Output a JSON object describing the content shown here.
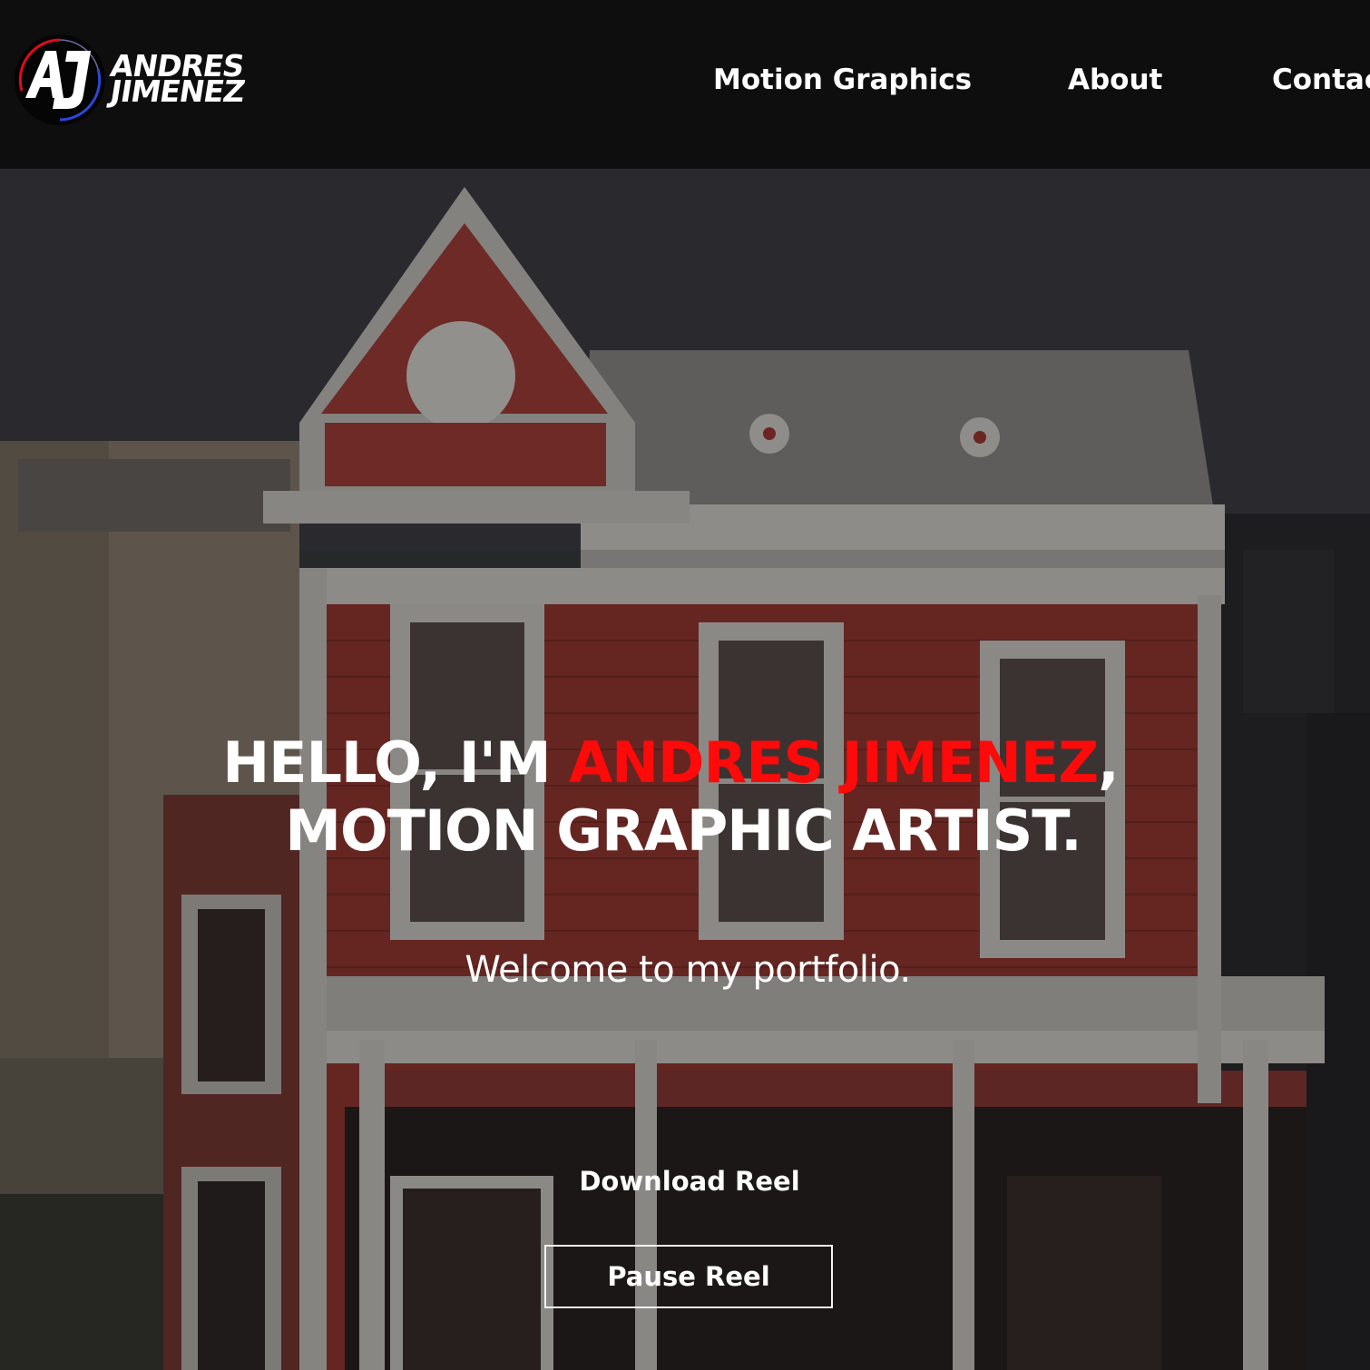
{
  "header": {
    "logo": {
      "monogram": "AJ",
      "first_name": "ANDRES",
      "last_name": "JIMENEZ"
    },
    "nav": [
      {
        "label": "Motion Graphics"
      },
      {
        "label": "About"
      },
      {
        "label": "Contac"
      }
    ]
  },
  "hero": {
    "headline_prefix": "HELLO, I'M ",
    "headline_name": "ANDRES JIMENEZ",
    "headline_suffix": ",",
    "headline_line2": "MOTION GRAPHIC ARTIST.",
    "welcome": "Welcome to my portfolio.",
    "download_label": "Download Reel",
    "pause_label": "Pause Reel"
  },
  "colors": {
    "accent": "#ff0a0a",
    "header_bg": "#0e0e0e",
    "text": "#ffffff"
  }
}
